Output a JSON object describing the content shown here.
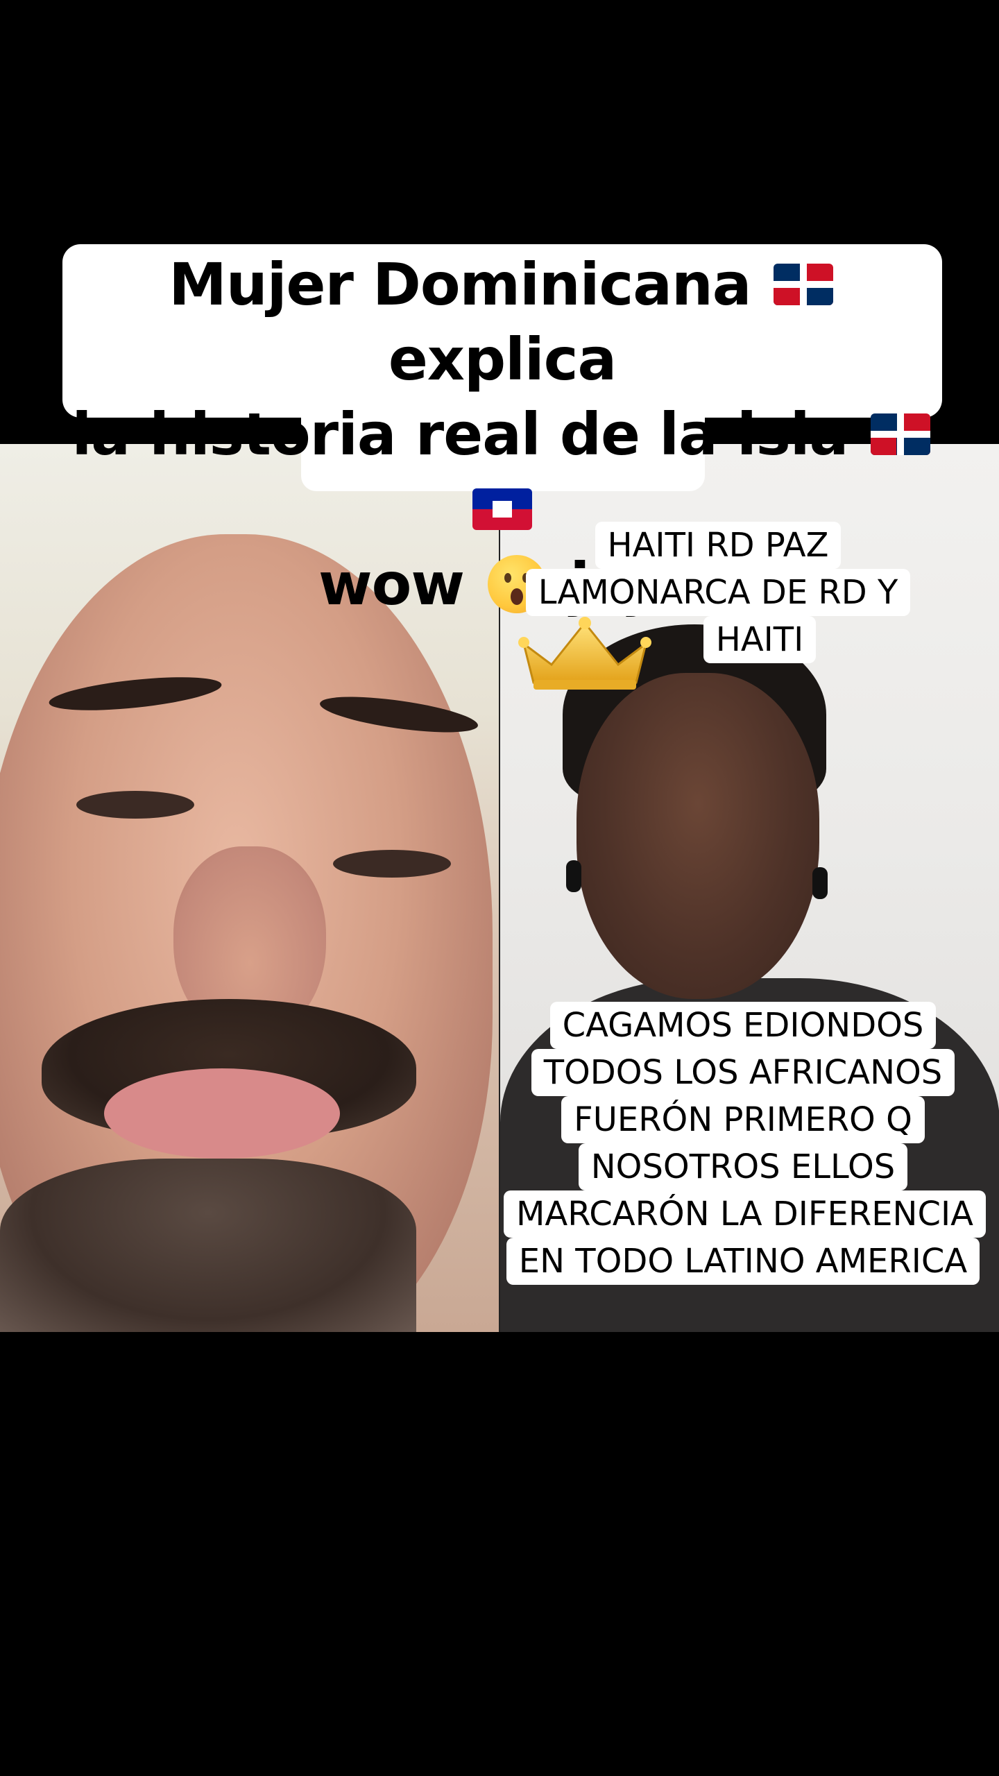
{
  "title": {
    "line1_part1": "Mujer Dominicana",
    "line1_part2": "explica",
    "line2_part1": "la historia real de la isla",
    "line3_part1": "wow",
    "line3_part2": "jeje",
    "flags": [
      "dominican-republic-flag",
      "dominican-republic-flag",
      "haiti-flag"
    ],
    "emoji": "surprised-face"
  },
  "left_panel": {
    "content": "man-face-video"
  },
  "right_panel": {
    "content": "woman-face-video",
    "caption_top": {
      "lines": [
        "HAITI RD PAZ",
        "LAMONARCA DE RD Y",
        "HAITI"
      ],
      "icon": "crown"
    },
    "caption_bottom": {
      "lines": [
        "CAGAMOS EDIONDOS",
        "TODOS LOS AFRICANOS",
        "FUERÓN PRIMERO Q",
        "NOSOTROS ELLOS",
        "MARCARÓN LA DIFERENCIA",
        "EN TODO LATINO AMERICA"
      ]
    }
  },
  "colors": {
    "background": "#000000",
    "caption_bg": "#ffffff",
    "text": "#000000"
  }
}
